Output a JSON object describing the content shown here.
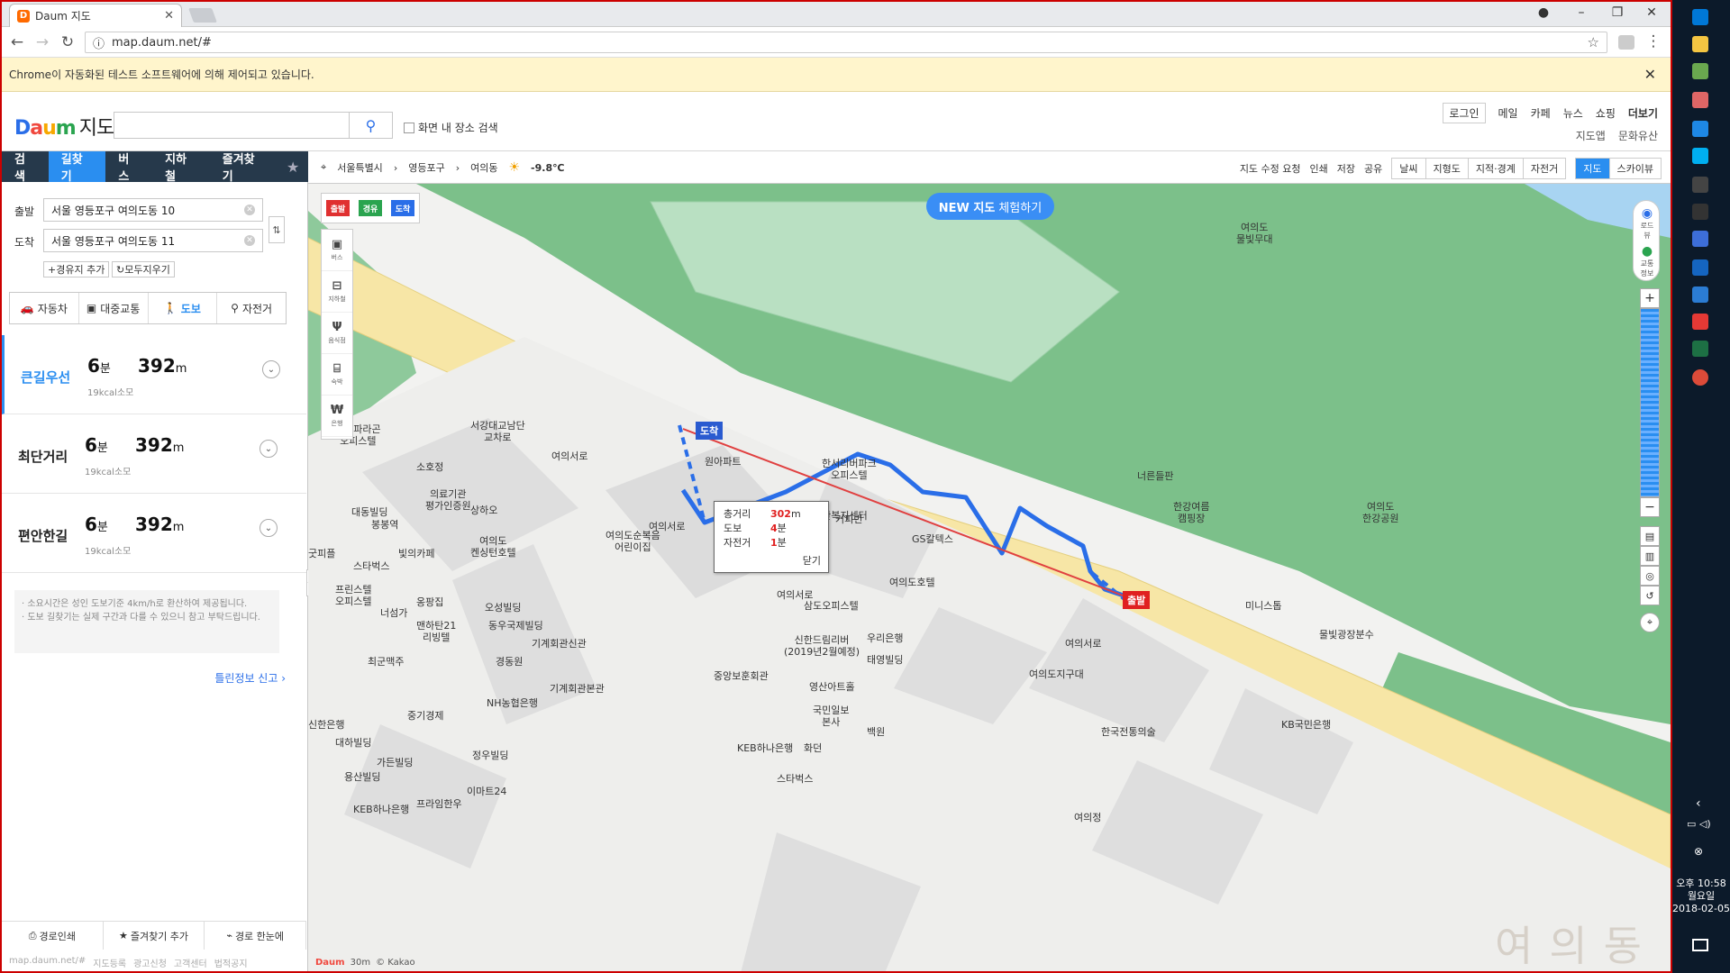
{
  "browser": {
    "tab_title": "Daum 지도",
    "url": "map.daum.net/#",
    "infobar": "Chrome이 자동화된 테스트 소프트웨어에 의해 제어되고 있습니다."
  },
  "header": {
    "logo_brand": "Daum",
    "logo_text": "지도",
    "search_placeholder": "",
    "area_search_label": "화면 내 장소 검색",
    "top_links": [
      "로그인",
      "메일",
      "카페",
      "뉴스",
      "쇼핑",
      "더보기"
    ],
    "sub_links": [
      "지도앱",
      "문화유산"
    ]
  },
  "left": {
    "tabs": [
      "검색",
      "길찾기",
      "버스",
      "지하철",
      "즐겨찾기"
    ],
    "origin_label": "출발",
    "origin_value": "서울 영등포구 여의도동 10",
    "dest_label": "도착",
    "dest_value": "서울 영등포구 여의도동 11",
    "add_waypoint": "경유지 추가",
    "clear_all": "모두지우기",
    "modes": [
      "자동차",
      "대중교통",
      "도보",
      "자전거"
    ],
    "routes": [
      {
        "name": "큰길우선",
        "min": "6",
        "min_unit": "분",
        "dist": "392",
        "dist_unit": "m",
        "kcal": "19kcal소모"
      },
      {
        "name": "최단거리",
        "min": "6",
        "min_unit": "분",
        "dist": "392",
        "dist_unit": "m",
        "kcal": "19kcal소모"
      },
      {
        "name": "편안한길",
        "min": "6",
        "min_unit": "분",
        "dist": "392",
        "dist_unit": "m",
        "kcal": "19kcal소모"
      }
    ],
    "note1": "· 소요시간은 성인 도보기준 4km/h로 환산하여 제공됩니다.",
    "note2": "· 도보 길찾기는 실제 구간과 다를 수 있으니 참고 부탁드립니다.",
    "report": "틀린정보 신고 ›",
    "bottom": [
      "경로인쇄",
      "즐겨찾기 추가",
      "경로 한눈에"
    ],
    "footer": [
      "map.daum.net/#",
      "지도등록",
      "광고신청",
      "고객센터",
      "법적공지"
    ]
  },
  "map_toolbar": {
    "crumbs": [
      "서울특별시",
      "영등포구",
      "여의동"
    ],
    "temperature": "-9.8℃",
    "right_links": [
      "지도 수정 요청",
      "인쇄",
      "저장",
      "공유"
    ],
    "layers": [
      "날씨",
      "지형도",
      "지적·경계",
      "자전거"
    ],
    "map_types": [
      "지도",
      "스카이뷰"
    ]
  },
  "map": {
    "new_map_bold": "NEW 지도",
    "new_map_rest": "체험하기",
    "flag_tools": [
      "출발",
      "경유",
      "도착"
    ],
    "side_tools": [
      "버스",
      "지하철",
      "음식점",
      "숙박",
      "은행"
    ],
    "right_ctrl": [
      "로드뷰",
      "교통정보"
    ],
    "info": {
      "rows": [
        {
          "k": "총거리",
          "v": "302",
          "u": "m"
        },
        {
          "k": "도보",
          "v": "4",
          "u": "분"
        },
        {
          "k": "자전거",
          "v": "1",
          "u": "분"
        }
      ],
      "close": "닫기"
    },
    "pin_start": "출발",
    "pin_end": "도착",
    "scale": "30m",
    "copyright": "© Kakao",
    "district_watermark": "여의동",
    "labels": [
      "서강대교남단\n교차로",
      "여의서로",
      "여의서로",
      "여의서로",
      "여의서로",
      "여의도\n물빛무대",
      "너른들판",
      "한강여름\n캠핑장",
      "여의도\n한강공원",
      "미니스톱",
      "물빛광장분수",
      "진미파라곤\n오피스텔",
      "소호정",
      "의료기관\n평가인증원",
      "대동빌딩",
      "봉봉역",
      "상하오",
      "여의도\n켄싱턴호텔",
      "여의도순복음\n어린이집",
      "원아파트",
      "한서리버파크\n오피스텔",
      "영산복지센터",
      "커피빈",
      "순복음\n실업인선교회",
      "GS칼텍스",
      "여의도호텔",
      "KB국민은행",
      "빛의카페",
      "굿피플",
      "스타벅스",
      "프린스텔\n오피스텔",
      "너섬가",
      "옹팡집",
      "오성빌딩",
      "동우국제빌딩",
      "기계회관신관",
      "경동원",
      "기계회관본관",
      "NH농협은행",
      "맨하탄21\n리빙텔",
      "최군맥주",
      "중기경제",
      "신한은행",
      "대하빌딩",
      "가든빌딩",
      "용산빌딩",
      "정우빌딩",
      "이마트24",
      "KEB하나은행",
      "프라임한우",
      "삼도오피스텔",
      "신한드림리버\n(2019년2월예정)",
      "중앙보훈회관",
      "영산아트홀",
      "국민일보\n본사",
      "백원",
      "KEB하나은행",
      "화던",
      "스타벅스",
      "우리은행",
      "태영빌딩",
      "여의도지구대",
      "한국전통의술",
      "여의정"
    ]
  },
  "taskbar": {
    "time": "오후 10:58",
    "day": "월요일",
    "date": "2018-02-05"
  }
}
